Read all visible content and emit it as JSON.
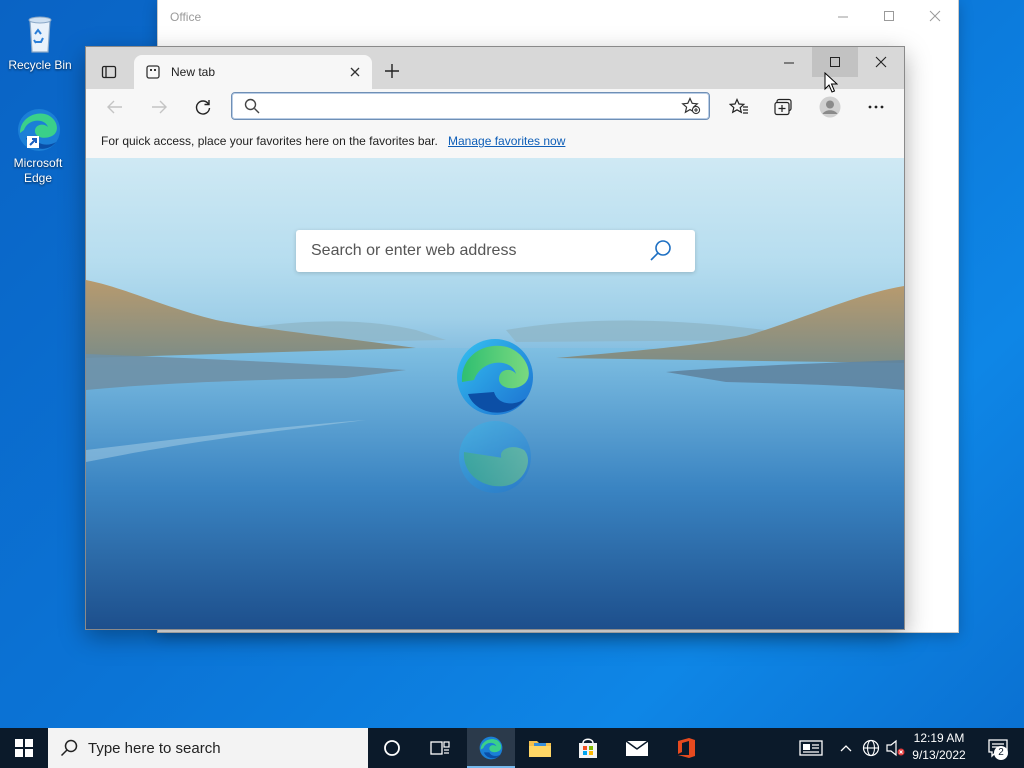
{
  "desktop": {
    "icons": [
      {
        "label": "Recycle Bin",
        "icon": "recycle-bin-icon"
      },
      {
        "label": "Microsoft Edge",
        "icon": "edge-icon"
      }
    ]
  },
  "office_window": {
    "title": "Office"
  },
  "browser": {
    "tab": {
      "title": "New tab"
    },
    "address": {
      "value": ""
    },
    "favorites_bar": {
      "message": "For quick access, place your favorites here on the favorites bar.",
      "link": "Manage favorites now"
    },
    "newtab": {
      "search_placeholder": "Search or enter web address"
    }
  },
  "taskbar": {
    "search_placeholder": "Type here to search",
    "apps": [
      "task-view-icon",
      "edge-icon",
      "file-explorer-icon",
      "store-icon",
      "mail-icon",
      "office-icon"
    ],
    "clock": {
      "time": "12:19 AM",
      "date": "9/13/2022"
    },
    "notifications_count": "2"
  },
  "colors": {
    "accent": "#0b74d6",
    "taskbar": "#0b1a2a",
    "link": "#0f5fb8"
  }
}
